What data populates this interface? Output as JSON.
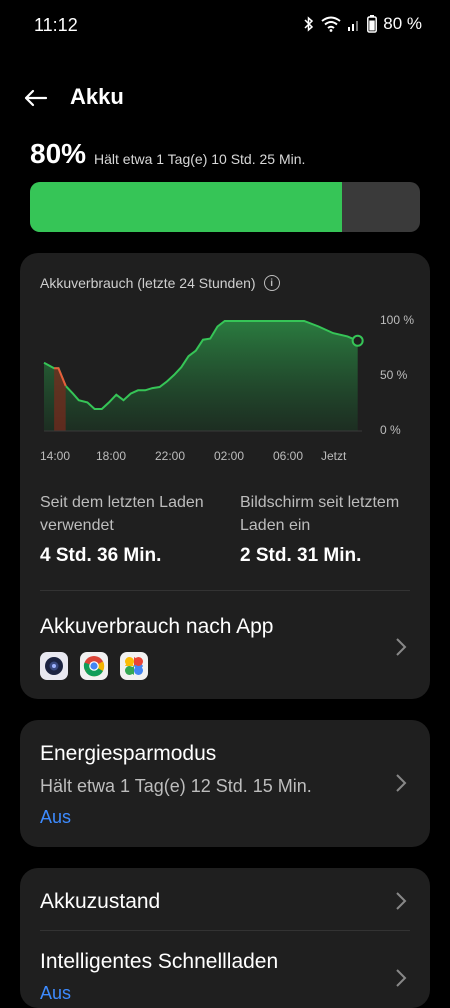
{
  "status_bar": {
    "time": "11:12",
    "battery_text": "80 %",
    "icons": [
      "bluetooth-icon",
      "wifi-icon",
      "signal-icon",
      "battery-icon"
    ]
  },
  "header": {
    "title": "Akku",
    "back_icon": "arrow-left-icon"
  },
  "battery": {
    "percent_label": "80%",
    "estimate": "Hält etwa 1 Tag(e) 10 Std. 25 Min.",
    "level": 0.8,
    "fill_color": "#36c557"
  },
  "usage_card": {
    "title": "Akkuverbrauch (letzte 24 Stunden)",
    "chart_data": {
      "type": "area",
      "title": "Akkuverbrauch (letzte 24 Stunden)",
      "x_ticks": [
        "14:00",
        "18:00",
        "22:00",
        "02:00",
        "06:00",
        "Jetzt"
      ],
      "y_ticks": [
        "100 %",
        "50 %",
        "0 %"
      ],
      "ylim": [
        0,
        100
      ],
      "xlim": [
        13,
        35
      ],
      "grid": false,
      "series": [
        {
          "color": "#36c557",
          "x": [
            13,
            13.7,
            14.0,
            14.5,
            15.0,
            15.4,
            16.0,
            16.5,
            17.0,
            17.5,
            18.0,
            18.5,
            19.0,
            19.5,
            20.0,
            20.5,
            21.0,
            21.5,
            22.0,
            22.5,
            23.0,
            23.5,
            24.0,
            24.5,
            25.0,
            25.5,
            26.0,
            27.0,
            28.0,
            29.0,
            30.0,
            31.0,
            32.0,
            33.0,
            34.0,
            34.7
          ],
          "y": [
            62,
            57,
            57,
            41,
            34,
            28,
            26,
            20,
            20,
            26,
            33,
            28,
            34,
            37,
            37,
            39,
            40,
            45,
            51,
            58,
            68,
            73,
            83,
            84,
            95,
            100,
            100,
            100,
            100,
            100,
            100,
            100,
            95,
            89,
            86,
            82
          ]
        },
        {
          "color": "#e85b3a",
          "x": [
            13.7,
            14.0,
            14.5
          ],
          "y": [
            57,
            57,
            41
          ]
        }
      ]
    },
    "stats": [
      {
        "label": "Seit dem letzten Laden verwendet",
        "value": "4 Std. 36 Min."
      },
      {
        "label": "Bildschirm seit letztem Laden ein",
        "value": "2 Std. 31 Min."
      }
    ],
    "by_app": {
      "title": "Akkuverbrauch nach App",
      "apps": [
        "camera-app-icon",
        "chrome-app-icon",
        "photos-app-icon"
      ]
    }
  },
  "power_saving": {
    "title": "Energiesparmodus",
    "subtitle": "Hält etwa 1 Tag(e) 12 Std. 15 Min.",
    "status": "Aus"
  },
  "health": {
    "title": "Akkuzustand"
  },
  "fast_charge": {
    "title": "Intelligentes Schnellladen",
    "status": "Aus"
  }
}
